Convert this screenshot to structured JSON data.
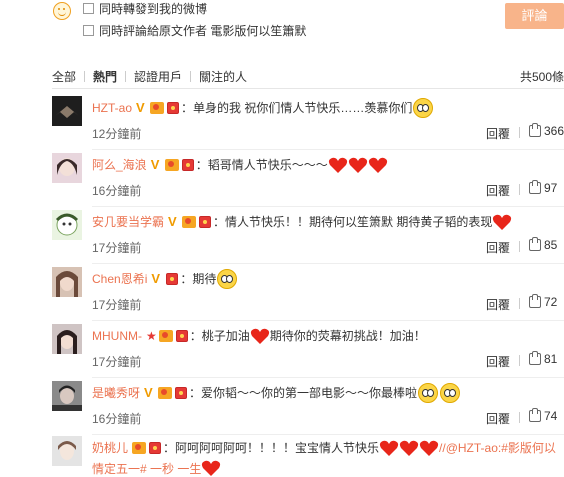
{
  "composer": {
    "option_repost": "同時轉發到我的微博",
    "option_comment_original": "同時評論給原文作者 電影版何以笙簫默",
    "submit_label": "評論"
  },
  "tabs": [
    {
      "label": "全部",
      "active": false
    },
    {
      "label": "熱門",
      "active": true
    },
    {
      "label": "認證用戶",
      "active": false
    },
    {
      "label": "關注的人",
      "active": false
    }
  ],
  "total_label": "共500條",
  "reply_label": "回覆",
  "comments": [
    {
      "username": "HZT-ao",
      "text": "：单身的我 祝你们情人节快乐……羡慕你们",
      "time": "12分鐘前",
      "likes": "366",
      "avatar_color": "#2a2a2a"
    },
    {
      "username": "阿么_海浪",
      "text": "：韬哥情人节快乐～～～",
      "time": "16分鐘前",
      "likes": "97",
      "avatar_color": "#c9a7b5"
    },
    {
      "username": "安几要当学霸",
      "text": "：情人节快乐！！期待何以笙箫默 期待黄子韬的表现",
      "time": "17分鐘前",
      "likes": "85",
      "avatar_color": "#8fbf7a"
    },
    {
      "username": "Chen恩希i",
      "text": "：期待",
      "time": "17分鐘前",
      "likes": "72",
      "avatar_color": "#b89484"
    },
    {
      "username": "MHUNM-",
      "text": "：桃子加油",
      "text2": "期待你的荧幕初挑战！加油！",
      "time": "17分鐘前",
      "likes": "81",
      "avatar_color": "#5a4a4a"
    },
    {
      "username": "是曦秀呀",
      "text": "：爱你韬～～你的第一部电影～～你最棒啦",
      "time": "16分鐘前",
      "likes": "74",
      "avatar_color": "#6a6a6a"
    },
    {
      "username": "奶桃儿",
      "text": "：阿呵阿呵阿呵！！！！宝宝情人节快乐",
      "link": "//@HZT-ao:#影版何以",
      "text_line2": "情定五一# 一秒 一生",
      "avatar_color": "#cfcfcf"
    }
  ]
}
